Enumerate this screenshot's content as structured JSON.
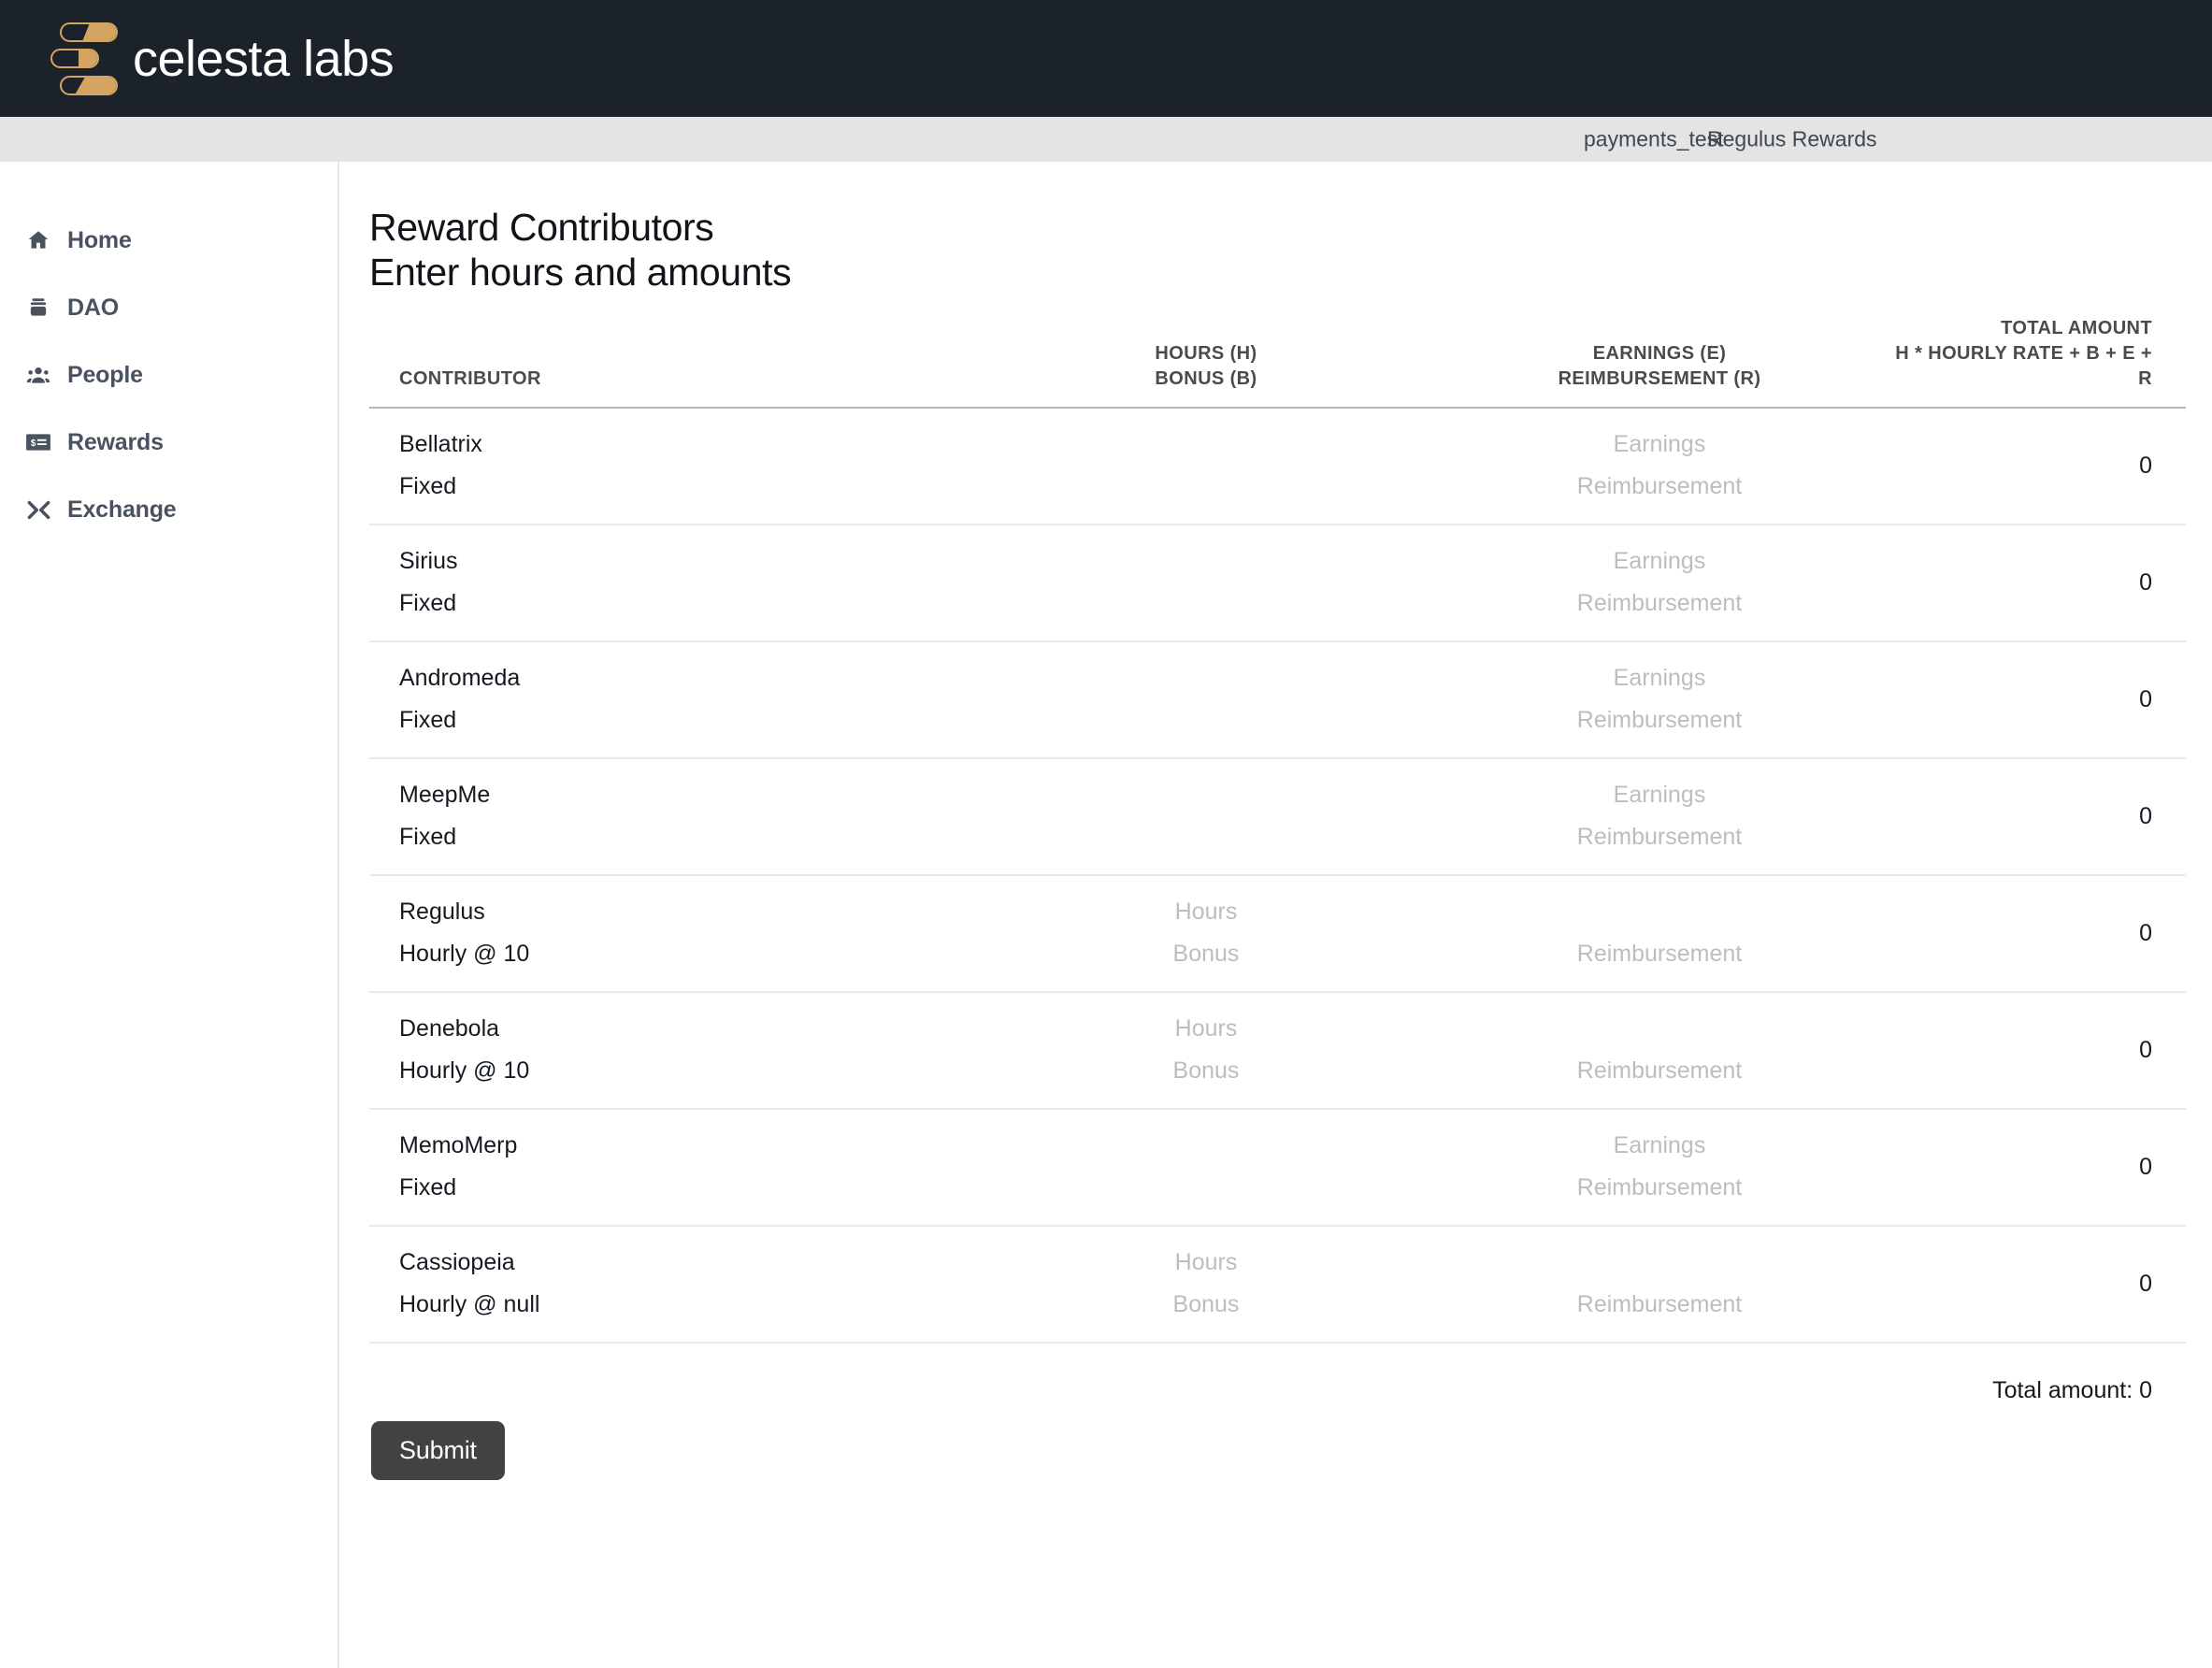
{
  "header": {
    "brand": "celesta labs",
    "logo_color": "#d4a460",
    "background": "#1b222a"
  },
  "navstrip": {
    "background": "#e4e4e4",
    "items": [
      {
        "label": "payments_test"
      },
      {
        "label": "Regulus Rewards"
      }
    ]
  },
  "sidebar": {
    "items": [
      {
        "label": "Home",
        "icon": "home-icon"
      },
      {
        "label": "DAO",
        "icon": "dao-icon"
      },
      {
        "label": "People",
        "icon": "people-icon"
      },
      {
        "label": "Rewards",
        "icon": "rewards-icon"
      },
      {
        "label": "Exchange",
        "icon": "exchange-icon"
      }
    ]
  },
  "main": {
    "title": "Reward Contributors",
    "subtitle": "Enter hours and amounts",
    "table": {
      "headers": {
        "contributor": "CONTRIBUTOR",
        "hours_line1": "HOURS (H)",
        "hours_line2": "BONUS (B)",
        "earnings_line1": "EARNINGS (E)",
        "earnings_line2": "REIMBURSEMENT (R)",
        "total_line1": "TOTAL AMOUNT",
        "total_line2": "H * HOURLY RATE + B + E + R"
      },
      "rows": [
        {
          "name": "Bellatrix",
          "type": "Fixed",
          "hours_placeholder": "",
          "bonus_placeholder": "",
          "earnings_placeholder": "Earnings",
          "reimbursement_placeholder": "Reimbursement",
          "total": "0"
        },
        {
          "name": "Sirius",
          "type": "Fixed",
          "hours_placeholder": "",
          "bonus_placeholder": "",
          "earnings_placeholder": "Earnings",
          "reimbursement_placeholder": "Reimbursement",
          "total": "0"
        },
        {
          "name": "Andromeda",
          "type": "Fixed",
          "hours_placeholder": "",
          "bonus_placeholder": "",
          "earnings_placeholder": "Earnings",
          "reimbursement_placeholder": "Reimbursement",
          "total": "0"
        },
        {
          "name": "MeepMe",
          "type": "Fixed",
          "hours_placeholder": "",
          "bonus_placeholder": "",
          "earnings_placeholder": "Earnings",
          "reimbursement_placeholder": "Reimbursement",
          "total": "0"
        },
        {
          "name": "Regulus",
          "type": "Hourly @ 10",
          "hours_placeholder": "Hours",
          "bonus_placeholder": "Bonus",
          "earnings_placeholder": "",
          "reimbursement_placeholder": "Reimbursement",
          "total": "0"
        },
        {
          "name": "Denebola",
          "type": "Hourly @ 10",
          "hours_placeholder": "Hours",
          "bonus_placeholder": "Bonus",
          "earnings_placeholder": "",
          "reimbursement_placeholder": "Reimbursement",
          "total": "0"
        },
        {
          "name": "MemoMerp",
          "type": "Fixed",
          "hours_placeholder": "",
          "bonus_placeholder": "",
          "earnings_placeholder": "Earnings",
          "reimbursement_placeholder": "Reimbursement",
          "total": "0"
        },
        {
          "name": "Cassiopeia",
          "type": "Hourly @ null",
          "hours_placeholder": "Hours",
          "bonus_placeholder": "Bonus",
          "earnings_placeholder": "",
          "reimbursement_placeholder": "Reimbursement",
          "total": "0"
        }
      ]
    },
    "footer": {
      "total_label": "Total amount: 0",
      "submit_label": "Submit"
    }
  }
}
